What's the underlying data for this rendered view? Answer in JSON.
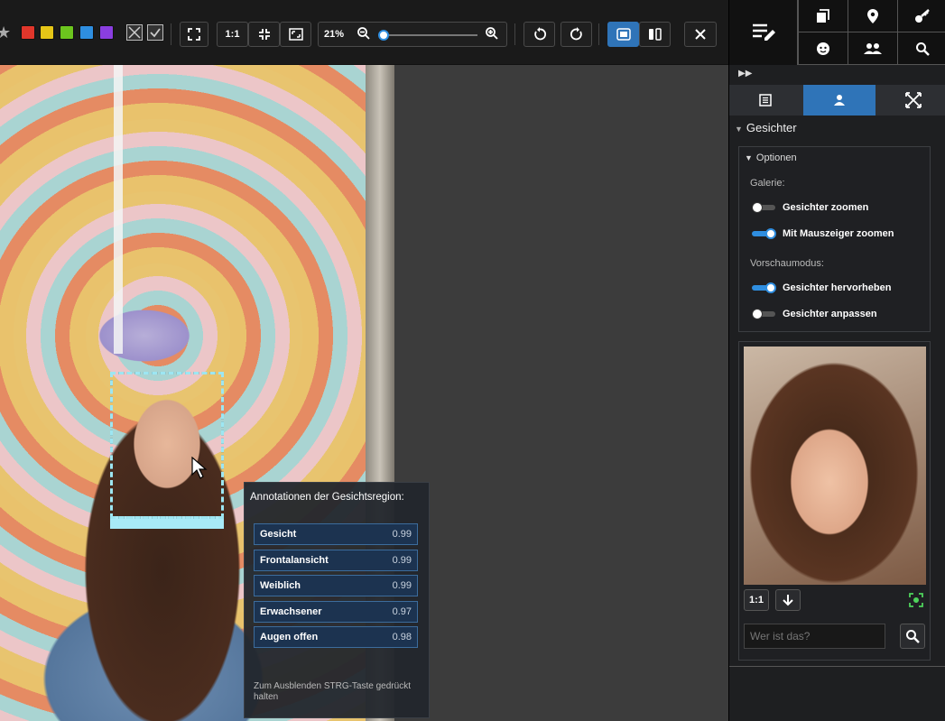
{
  "toolbar": {
    "ratio_label": "1:1",
    "zoom_text": "21%",
    "zoom_level": 0.21,
    "color_labels": [
      {
        "name": "red",
        "color": "#e0362b"
      },
      {
        "name": "yellow",
        "color": "#e6c617"
      },
      {
        "name": "green",
        "color": "#6cc51e"
      },
      {
        "name": "blue",
        "color": "#2e8ee0"
      },
      {
        "name": "purple",
        "color": "#8a3ee0"
      }
    ]
  },
  "tooltip": {
    "title": "Annotationen der Gesichtsregion:",
    "rows": [
      {
        "label": "Gesicht",
        "value": "0.99"
      },
      {
        "label": "Frontalansicht",
        "value": "0.99"
      },
      {
        "label": "Weiblich",
        "value": "0.99"
      },
      {
        "label": "Erwachsener",
        "value": "0.97"
      },
      {
        "label": "Augen offen",
        "value": "0.98"
      }
    ],
    "footer": "Zum Ausblenden STRG-Taste gedrückt halten"
  },
  "panel": {
    "section_title": "Gesichter",
    "options": {
      "title": "Optionen",
      "gallery_label": "Galerie:",
      "preview_label": "Vorschaumodus:",
      "toggles": [
        {
          "text": "Gesichter zoomen",
          "on": false
        },
        {
          "text": "Mit Mauszeiger zoomen",
          "on": true
        },
        {
          "text": "Gesichter hervorheben",
          "on": true
        },
        {
          "text": "Gesichter anpassen",
          "on": false
        }
      ]
    },
    "preview": {
      "ratio_label": "1:1",
      "name_placeholder": "Wer ist das?"
    }
  },
  "colors": {
    "accent": "#2f74b8",
    "tooltip_row_bg": "#1c3350",
    "face_box_outline": "#9de6f2"
  }
}
